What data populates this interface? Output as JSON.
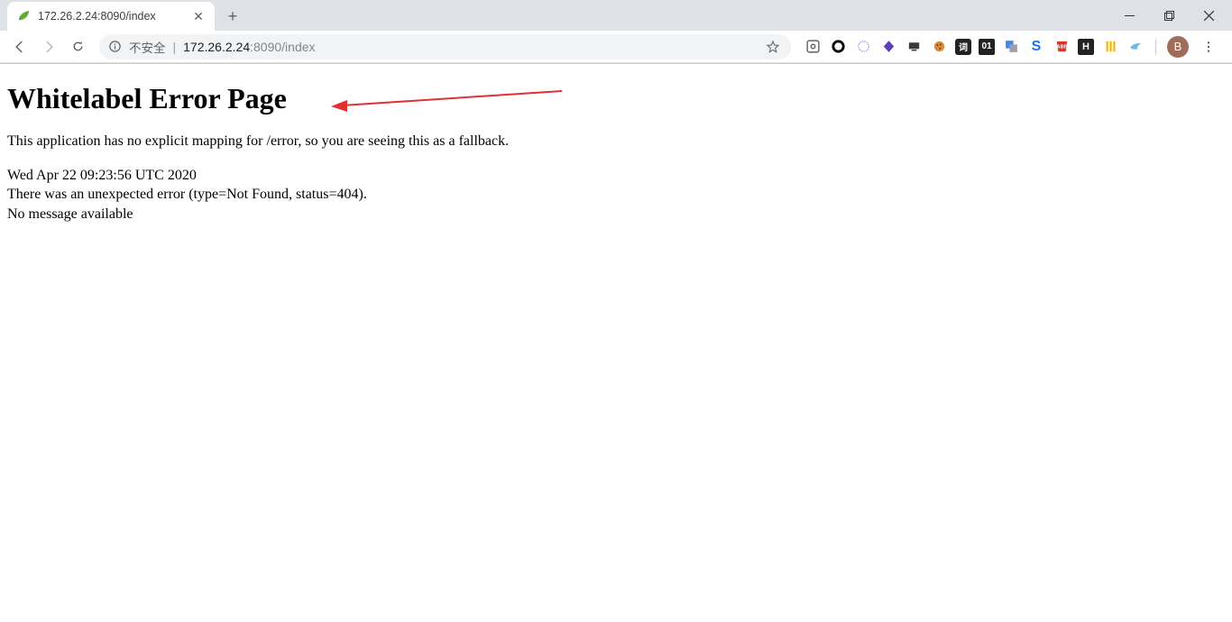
{
  "browser": {
    "tab": {
      "title": "172.26.2.24:8090/index",
      "favicon": "leaf"
    },
    "address": {
      "security_label": "不安全",
      "host": "172.26.2.24",
      "port": ":8090",
      "path": "/index"
    },
    "avatar_initial": "B",
    "extensions": [
      "ext-origin",
      "ext-circle",
      "ext-globe",
      "ext-diamond",
      "ext-monitor",
      "ext-cookie",
      "ext-youdao",
      "ext-01",
      "ext-gtranslate",
      "ext-s",
      "ext-abp",
      "ext-h",
      "ext-bars",
      "ext-bird"
    ]
  },
  "page": {
    "heading": "Whitelabel Error Page",
    "description": "This application has no explicit mapping for /error, so you are seeing this as a fallback.",
    "timestamp": "Wed Apr 22 09:23:56 UTC 2020",
    "error_line": "There was an unexpected error (type=Not Found, status=404).",
    "message_line": "No message available"
  }
}
